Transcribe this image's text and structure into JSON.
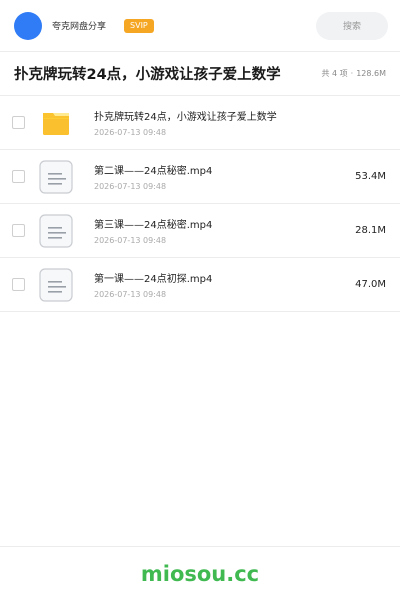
{
  "header": {
    "user_name": "夸克网盘分享",
    "vip_label": "SVIP",
    "search_label": "搜索"
  },
  "title_bar": {
    "title": "扑克牌玩转24点，小游戏让孩子爱上数学",
    "count": "共 4 项",
    "separator": "·",
    "total_size": "128.6M"
  },
  "files": [
    {
      "type": "folder-icon",
      "name": "扑克牌玩转24点，小游戏让孩子爱上数学",
      "date": "2026-07-13 09:48",
      "size": ""
    },
    {
      "type": "video-file-icon",
      "name": "第二课——24点秘密.mp4",
      "date": "2026-07-13 09:48",
      "size": "53.4M"
    },
    {
      "type": "video-file-icon",
      "name": "第三课——24点秘密.mp4",
      "date": "2026-07-13 09:48",
      "size": "28.1M"
    },
    {
      "type": "video-file-icon",
      "name": "第一课——24点初探.mp4",
      "date": "2026-07-13 09:48",
      "size": "47.0M"
    }
  ],
  "footer": {
    "brand": "miosou.cc"
  },
  "colors": {
    "accent_blue": "#2f7cf6",
    "vip_orange": "#f5a623",
    "folder_yellow": "#fbc02d",
    "brand_green": "#3fb950"
  }
}
